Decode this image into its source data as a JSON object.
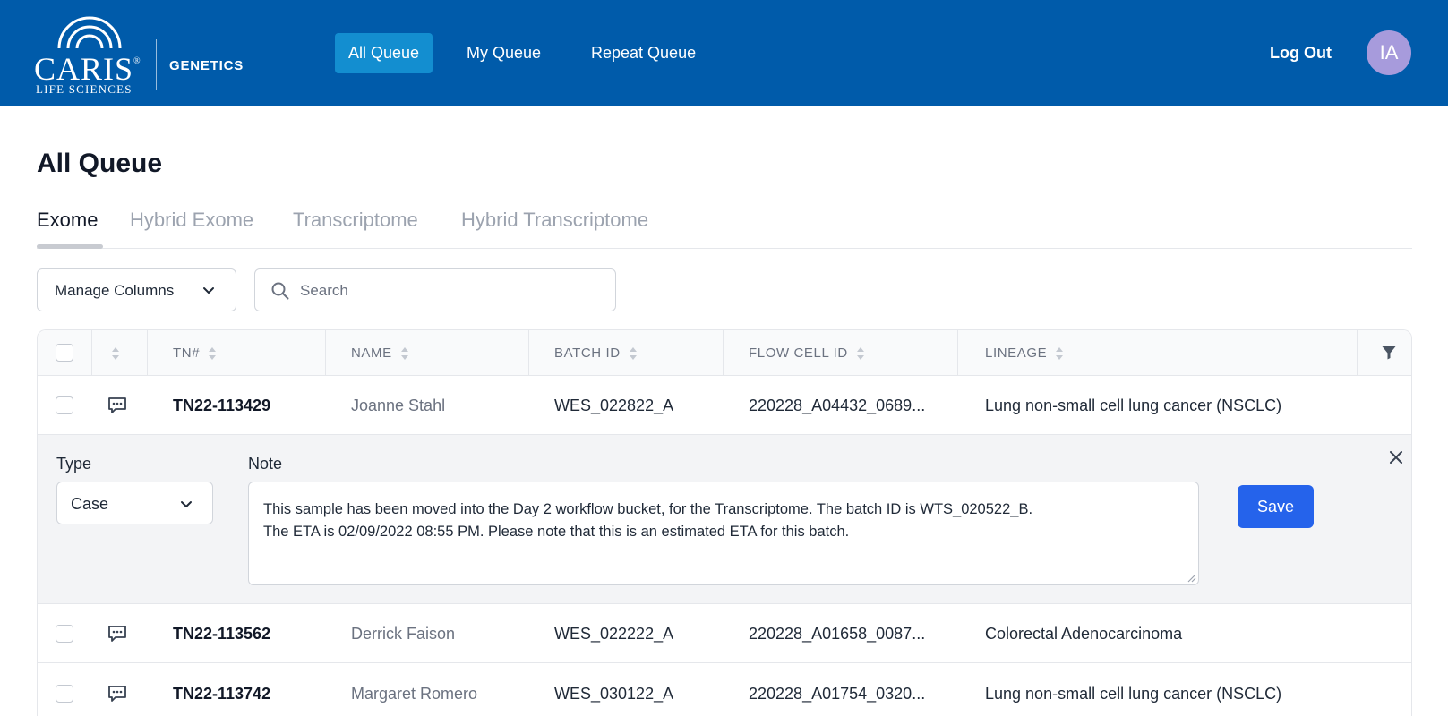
{
  "header": {
    "logo": {
      "word": "CARIS",
      "registered": "®",
      "subtitle": "LIFE SCIENCES",
      "product": "GENETICS"
    },
    "nav": [
      {
        "label": "All Queue",
        "active": true
      },
      {
        "label": "My Queue",
        "active": false
      },
      {
        "label": "Repeat Queue",
        "active": false
      }
    ],
    "logout_label": "Log Out",
    "avatar_initials": "IA",
    "colors": {
      "bar": "#005baa",
      "active_nav": "#138ed0",
      "avatar": "#a79bdc"
    }
  },
  "page": {
    "title": "All Queue"
  },
  "tabs": [
    {
      "label": "Exome",
      "active": true
    },
    {
      "label": "Hybrid Exome",
      "active": false
    },
    {
      "label": "Transcriptome",
      "active": false
    },
    {
      "label": "Hybrid Transcriptome",
      "active": false
    }
  ],
  "toolbar": {
    "manage_columns_label": "Manage Columns",
    "search_placeholder": "Search",
    "search_value": ""
  },
  "table": {
    "columns": [
      "TN#",
      "NAME",
      "BATCH ID",
      "FLOW CELL ID",
      "LINEAGE"
    ],
    "rows": [
      {
        "tn": "TN22-113429",
        "name": "Joanne Stahl",
        "batch_id": "WES_022822_A",
        "flow_cell_id": "220228_A04432_0689...",
        "lineage": "Lung non-small cell lung cancer (NSCLC)"
      },
      {
        "tn": "TN22-113562",
        "name": "Derrick Faison",
        "batch_id": "WES_022222_A",
        "flow_cell_id": "220228_A01658_0087...",
        "lineage": "Colorectal Adenocarcinoma"
      },
      {
        "tn": "TN22-113742",
        "name": "Margaret Romero",
        "batch_id": "WES_030122_A",
        "flow_cell_id": "220228_A01754_0320...",
        "lineage": "Lung non-small cell lung cancer (NSCLC)"
      }
    ]
  },
  "note_panel": {
    "type_label": "Type",
    "type_value": "Case",
    "note_label": "Note",
    "note_text": "This sample has been moved into the Day 2 workflow bucket, for the Transcriptome. The batch ID is WTS_020522_B.\nThe ETA is 02/09/2022 08:55 PM. Please note that this is an estimated ETA for this batch.",
    "save_label": "Save",
    "save_color": "#2563eb"
  },
  "icons": [
    "search-icon",
    "chevron-down-icon",
    "sort-icon",
    "filter-icon",
    "comment-icon",
    "close-icon"
  ]
}
